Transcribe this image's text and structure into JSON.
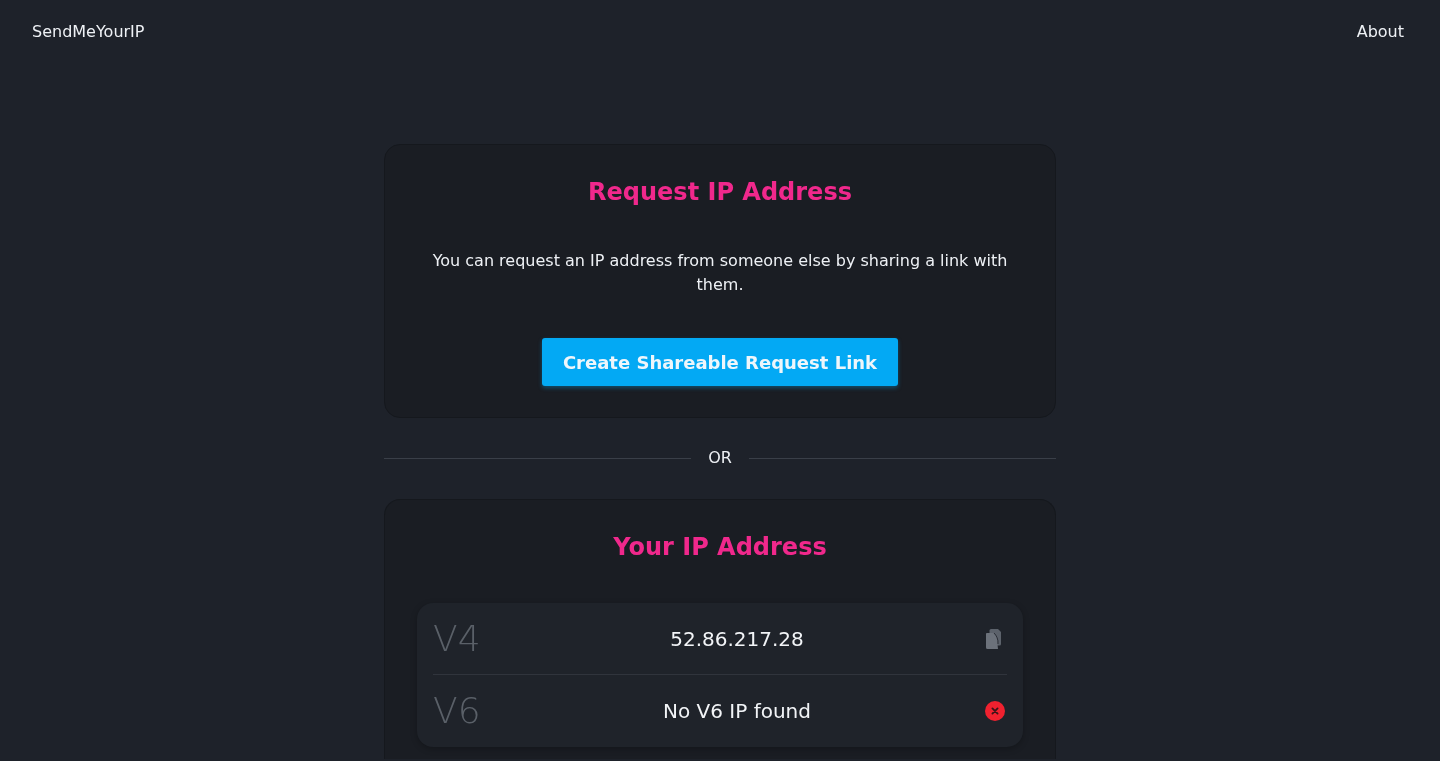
{
  "header": {
    "brand": "SendMeYourIP",
    "nav": [
      {
        "label": "About"
      }
    ]
  },
  "request_card": {
    "title": "Request IP Address",
    "description": "You can request an IP address from someone else by sharing a link with them.",
    "button": "Create Shareable Request Link"
  },
  "divider": {
    "label": "OR"
  },
  "ip_card": {
    "title": "Your IP Address",
    "rows": [
      {
        "label": "V4",
        "value": "52.86.217.28",
        "kind": "copy"
      },
      {
        "label": "V6",
        "value": "No V6 IP found",
        "kind": "error"
      }
    ]
  }
}
